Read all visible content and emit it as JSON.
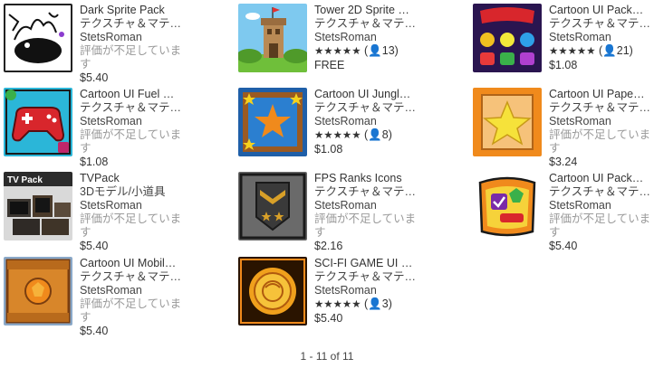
{
  "items": [
    {
      "title": "Dark Sprite Pack",
      "category": "テクスチャ＆マテ…",
      "publisher": "StetsRoman",
      "rating_text": "評価が不足しています",
      "price": "$5.40",
      "icon": "dark-sprite-thumbnail"
    },
    {
      "title": "Tower 2D Sprite …",
      "category": "テクスチャ＆マテ…",
      "publisher": "StetsRoman",
      "stars": "★★★★★",
      "rating_count": "(👤13)",
      "price": "FREE",
      "icon": "tower-thumbnail"
    },
    {
      "title": "Cartoon UI Pack…",
      "category": "テクスチャ＆マテ…",
      "publisher": "StetsRoman",
      "stars": "★★★★★",
      "rating_count": "(👤21)",
      "price": "$1.08",
      "icon": "cartoon-ui-thumbnail"
    },
    {
      "title": "Cartoon UI Fuel …",
      "category": "テクスチャ＆マテ…",
      "publisher": "StetsRoman",
      "rating_text": "評価が不足しています",
      "price": "$1.08",
      "icon": "gamepad-thumbnail"
    },
    {
      "title": "Cartoon UI Jungl…",
      "category": "テクスチャ＆マテ…",
      "publisher": "StetsRoman",
      "stars": "★★★★★",
      "rating_count": "(👤8)",
      "price": "$1.08",
      "icon": "star-frame-thumbnail"
    },
    {
      "title": "Cartoon UI Pape…",
      "category": "テクスチャ＆マテ…",
      "publisher": "StetsRoman",
      "rating_text": "評価が不足しています",
      "price": "$3.24",
      "icon": "paper-star-thumbnail"
    },
    {
      "title": "TVPack",
      "category": "3Dモデル/小道具",
      "publisher": "StetsRoman",
      "rating_text": "評価が不足しています",
      "price": "$5.40",
      "icon": "tv-pack-thumbnail"
    },
    {
      "title": "FPS Ranks Icons",
      "category": "テクスチャ＆マテ…",
      "publisher": "StetsRoman",
      "rating_text": "評価が不足しています",
      "price": "$2.16",
      "icon": "rank-badge-thumbnail"
    },
    {
      "title": "Cartoon UI Pack…",
      "category": "テクスチャ＆マテ…",
      "publisher": "StetsRoman",
      "rating_text": "評価が不足しています",
      "price": "$5.40",
      "icon": "cartoon-ui-pack-thumbnail"
    },
    {
      "title": "Cartoon UI Mobil…",
      "category": "テクスチャ＆マテ…",
      "publisher": "StetsRoman",
      "rating_text": "評価が不足しています",
      "price": "$5.40",
      "icon": "wood-crate-thumbnail"
    },
    {
      "title": "SCI-FI GAME UI …",
      "category": "テクスチャ＆マテ…",
      "publisher": "StetsRoman",
      "stars": "★★★★★",
      "rating_count": "(👤3)",
      "price": "$5.40",
      "icon": "scifi-ui-thumbnail"
    }
  ],
  "pagination": "1 - 11 of 11",
  "colors": {
    "orange": "#f08a1c",
    "dark": "#1a1a1a",
    "red": "#d9262c",
    "blue": "#1c7fd0"
  }
}
